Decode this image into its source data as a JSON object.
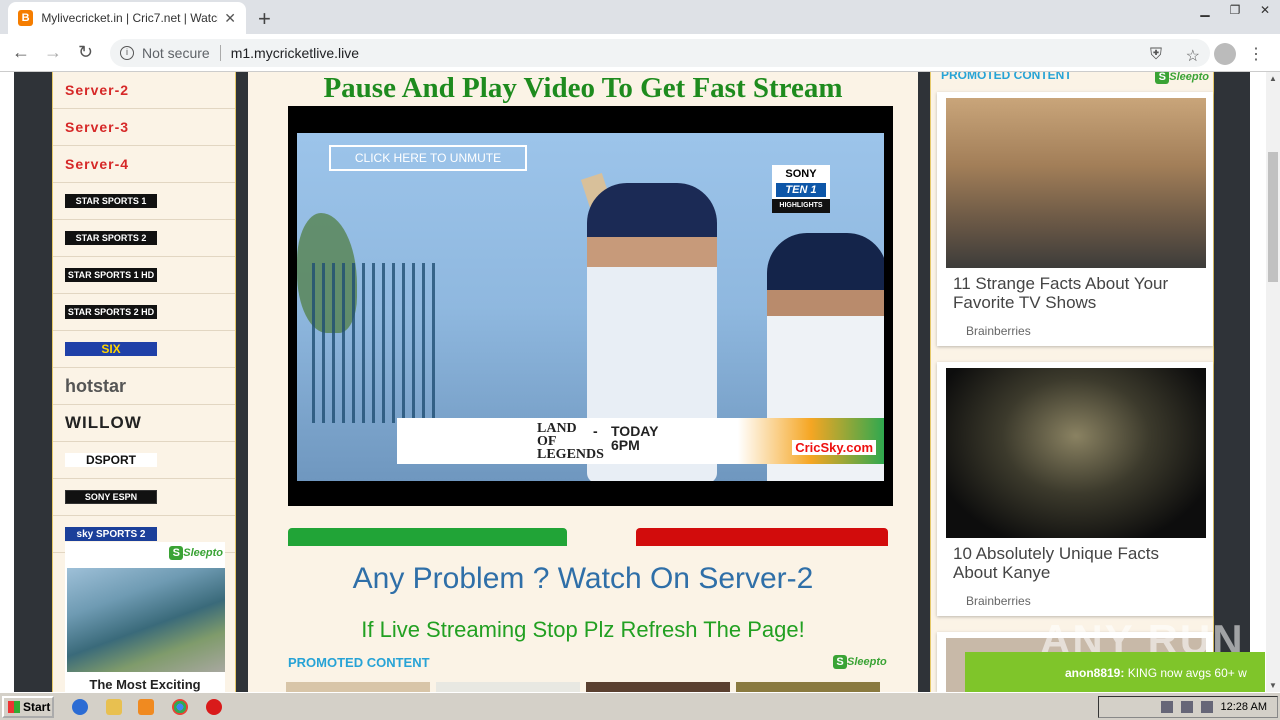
{
  "browser": {
    "tab_title": "Mylivecricket.in | Cric7.net | Watch L",
    "security_label": "Not secure",
    "url": "m1.mycricketlive.live"
  },
  "left_sidebar": {
    "servers": [
      "Server-2",
      "Server-3",
      "Server-4"
    ],
    "channels": [
      "STAR SPORTS 1",
      "STAR SPORTS 2",
      "STAR SPORTS 1 HD",
      "STAR SPORTS 2 HD",
      "SIX",
      "hotstar",
      "WILLOW",
      "DSPORT",
      "SONY ESPN",
      "sky SPORTS 2"
    ],
    "ad_caption": "The Most Exciting",
    "ad_badge": "Sleepto"
  },
  "main": {
    "headline": "Pause And Play Video To Get Fast Stream",
    "unmute_label": "CLICK HERE TO UNMUTE",
    "broadcaster": {
      "top": "SONY",
      "mid": "TEN 1",
      "bottom": "HIGHLIGHTS"
    },
    "banner": {
      "land": "LAND OF LEGENDS",
      "dash": "-",
      "today": "TODAY",
      "time": "6PM"
    },
    "watermark_site": "CricSky.com",
    "problem_text": "Any Problem ? Watch On Server-2",
    "refresh_text": "If Live Streaming Stop Plz Refresh The Page!",
    "promoted_label": "PROMOTED CONTENT",
    "promoted_badge": "Sleepto"
  },
  "right_sidebar": {
    "promoted_label": "PROMOTED CONTENT",
    "badge": "Sleepto",
    "cards": [
      {
        "title": "11 Strange Facts About Your Favorite TV Shows",
        "source": "Brainberries"
      },
      {
        "title": "10 Absolutely Unique Facts About Kanye",
        "source": "Brainberries"
      }
    ]
  },
  "chat_ticker": {
    "user": "anon8819:",
    "message": "KING now avgs 60+ w"
  },
  "overlay_watermark": "ANY RUN",
  "taskbar": {
    "start_label": "Start",
    "clock": "12:28 AM"
  }
}
